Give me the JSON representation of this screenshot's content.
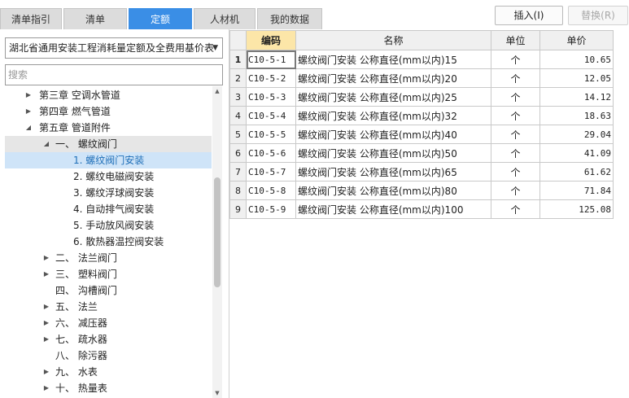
{
  "tabs": [
    {
      "label": "清单指引",
      "active": false
    },
    {
      "label": "清单",
      "active": false
    },
    {
      "label": "定额",
      "active": true
    },
    {
      "label": "人材机",
      "active": false
    },
    {
      "label": "我的数据",
      "active": false
    }
  ],
  "toolbar": {
    "insert_label": "插入(I)",
    "replace_label": "替换(R)"
  },
  "library_select": {
    "value": "湖北省通用安装工程消耗量定额及全费用基价表"
  },
  "search": {
    "placeholder": "搜索",
    "value": ""
  },
  "tree": [
    {
      "label": "第三章 空调水管道",
      "expanded": false
    },
    {
      "label": "第四章 燃气管道",
      "expanded": false
    },
    {
      "label": "第五章 管道附件",
      "expanded": true
    },
    {
      "label": "一、  螺纹阀门",
      "expanded": true
    },
    {
      "label": "1. 螺纹阀门安装",
      "selected": true
    },
    {
      "label": "2. 螺纹电磁阀安装"
    },
    {
      "label": "3. 螺纹浮球阀安装"
    },
    {
      "label": "4. 自动排气阀安装"
    },
    {
      "label": "5. 手动放风阀安装"
    },
    {
      "label": "6. 散热器温控阀安装"
    },
    {
      "label": "二、  法兰阀门",
      "expanded": false
    },
    {
      "label": "三、  塑料阀门",
      "expanded": false
    },
    {
      "label": "四、  沟槽阀门"
    },
    {
      "label": "五、  法兰",
      "expanded": false
    },
    {
      "label": "六、  减压器",
      "expanded": false
    },
    {
      "label": "七、  疏水器",
      "expanded": false
    },
    {
      "label": "八、  除污器"
    },
    {
      "label": "九、  水表",
      "expanded": false
    },
    {
      "label": "十、  热量表",
      "expanded": false
    }
  ],
  "table": {
    "headers": {
      "code": "编码",
      "name": "名称",
      "unit": "单位",
      "price": "单价"
    },
    "rows": [
      {
        "n": "1",
        "code": "C10-5-1",
        "name": "螺纹阀门安装 公称直径(mm以内)15",
        "unit": "个",
        "price": "10.65"
      },
      {
        "n": "2",
        "code": "C10-5-2",
        "name": "螺纹阀门安装 公称直径(mm以内)20",
        "unit": "个",
        "price": "12.05"
      },
      {
        "n": "3",
        "code": "C10-5-3",
        "name": "螺纹阀门安装 公称直径(mm以内)25",
        "unit": "个",
        "price": "14.12"
      },
      {
        "n": "4",
        "code": "C10-5-4",
        "name": "螺纹阀门安装 公称直径(mm以内)32",
        "unit": "个",
        "price": "18.63"
      },
      {
        "n": "5",
        "code": "C10-5-5",
        "name": "螺纹阀门安装 公称直径(mm以内)40",
        "unit": "个",
        "price": "29.04"
      },
      {
        "n": "6",
        "code": "C10-5-6",
        "name": "螺纹阀门安装 公称直径(mm以内)50",
        "unit": "个",
        "price": "41.09"
      },
      {
        "n": "7",
        "code": "C10-5-7",
        "name": "螺纹阀门安装 公称直径(mm以内)65",
        "unit": "个",
        "price": "61.62"
      },
      {
        "n": "8",
        "code": "C10-5-8",
        "name": "螺纹阀门安装 公称直径(mm以内)80",
        "unit": "个",
        "price": "71.84"
      },
      {
        "n": "9",
        "code": "C10-5-9",
        "name": "螺纹阀门安装 公称直径(mm以内)100",
        "unit": "个",
        "price": "125.08"
      }
    ]
  }
}
